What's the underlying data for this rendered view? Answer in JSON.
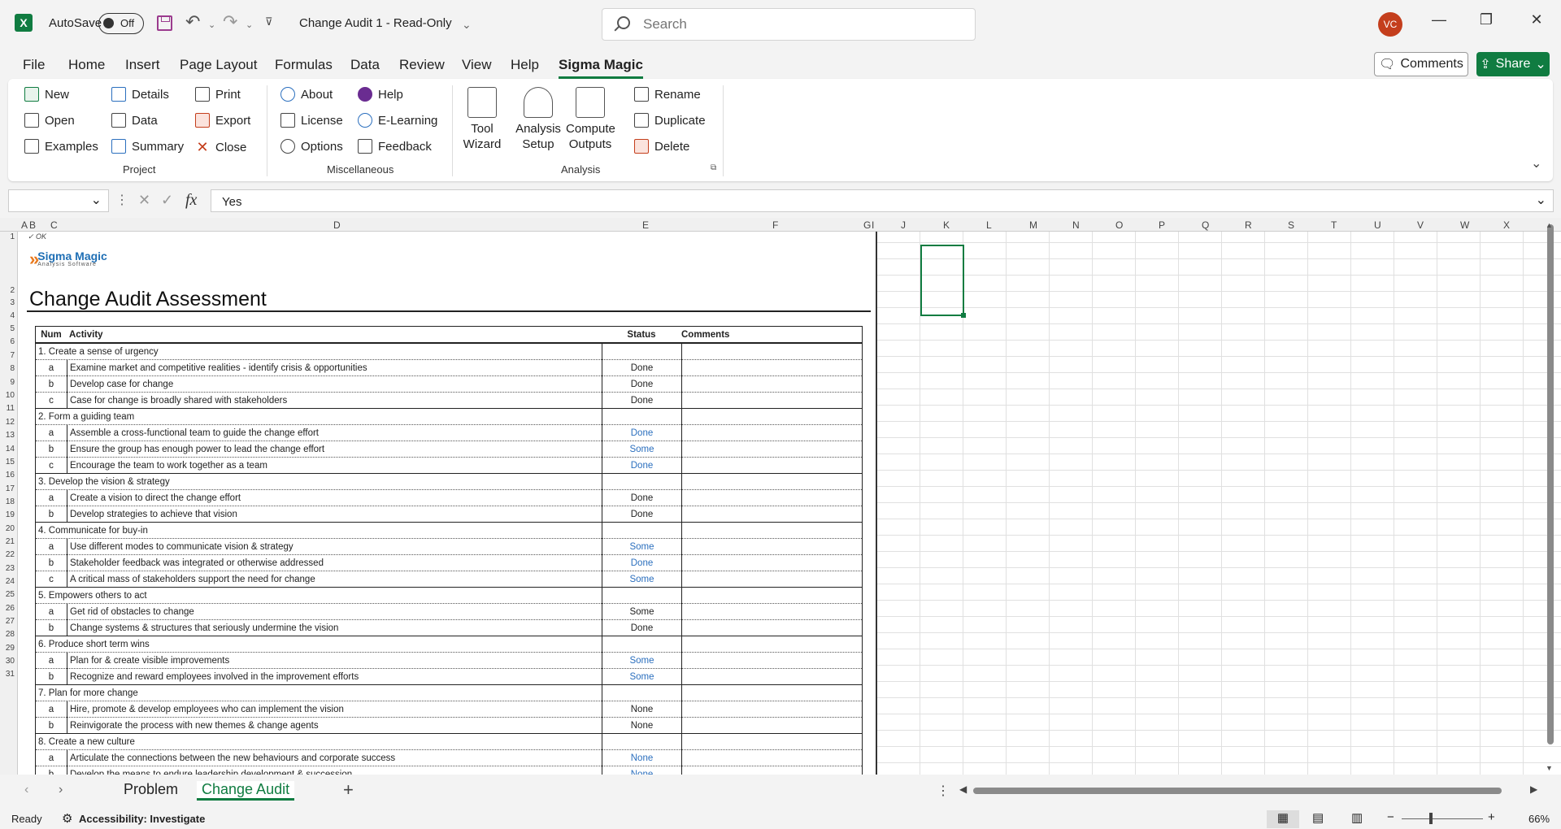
{
  "titlebar": {
    "autosave_label": "AutoSave",
    "autosave_state": "Off",
    "document_title": "Change Audit 1  -  Read-Only",
    "search_placeholder": "Search",
    "avatar_initials": "VC"
  },
  "menu": {
    "items": [
      "File",
      "Home",
      "Insert",
      "Page Layout",
      "Formulas",
      "Data",
      "Review",
      "View",
      "Help",
      "Sigma Magic"
    ],
    "active": "Sigma Magic",
    "comments_label": "Comments",
    "share_label": "Share"
  },
  "ribbon": {
    "project": {
      "label": "Project",
      "buttons": [
        "New",
        "Open",
        "Examples",
        "Details",
        "Data",
        "Summary",
        "Print",
        "Export",
        "Close"
      ]
    },
    "misc": {
      "label": "Miscellaneous",
      "buttons": [
        "About",
        "License",
        "Options",
        "Help",
        "E-Learning",
        "Feedback"
      ]
    },
    "analysis": {
      "label": "Analysis",
      "tool_wizard": "Tool Wizard",
      "analysis_setup": "Analysis Setup",
      "compute_outputs": "Compute Outputs",
      "buttons": [
        "Rename",
        "Duplicate",
        "Delete"
      ]
    }
  },
  "formula_bar": {
    "name_box": "",
    "fx": "fx",
    "value": "Yes"
  },
  "columns": [
    "A",
    "B",
    "C",
    "D",
    "E",
    "F",
    "G",
    "I",
    "J",
    "K",
    "L",
    "M",
    "N",
    "O",
    "P",
    "Q",
    "R",
    "S",
    "T",
    "U",
    "V",
    "W",
    "X"
  ],
  "rows": [
    "1",
    "2",
    "3",
    "4",
    "5",
    "6",
    "7",
    "8",
    "9",
    "10",
    "11",
    "12",
    "13",
    "14",
    "15",
    "16",
    "17",
    "18",
    "19",
    "20",
    "21",
    "22",
    "23",
    "24",
    "25",
    "26",
    "27",
    "28",
    "29",
    "30",
    "31"
  ],
  "sheet": {
    "ok_mark": "✓ OK",
    "logo_name": "Sigma Magic",
    "logo_sub": "Analysis Software",
    "title": "Change Audit Assessment",
    "headers": {
      "num": "Num",
      "activity": "Activity",
      "status": "Status",
      "comments": "Comments"
    },
    "rows": [
      {
        "type": "cat",
        "text": "1. Create a sense of urgency"
      },
      {
        "type": "item",
        "num": "a",
        "activity": "Examine market and competitive realities - identify crisis & opportunities",
        "status": "Done",
        "color": "black"
      },
      {
        "type": "item",
        "num": "b",
        "activity": "Develop case for change",
        "status": "Done",
        "color": "black"
      },
      {
        "type": "item",
        "num": "c",
        "activity": "Case for change is broadly shared with stakeholders",
        "status": "Done",
        "color": "black"
      },
      {
        "type": "cat",
        "text": "2. Form a guiding team"
      },
      {
        "type": "item",
        "num": "a",
        "activity": "Assemble a cross-functional team to guide the change effort",
        "status": "Done",
        "color": "blue"
      },
      {
        "type": "item",
        "num": "b",
        "activity": "Ensure the group has enough power to lead the change effort",
        "status": "Some",
        "color": "blue"
      },
      {
        "type": "item",
        "num": "c",
        "activity": "Encourage the team to work together as a team",
        "status": "Done",
        "color": "blue"
      },
      {
        "type": "cat",
        "text": "3. Develop the vision & strategy"
      },
      {
        "type": "item",
        "num": "a",
        "activity": "Create a vision to direct the change effort",
        "status": "Done",
        "color": "black"
      },
      {
        "type": "item",
        "num": "b",
        "activity": "Develop strategies to achieve that vision",
        "status": "Done",
        "color": "black"
      },
      {
        "type": "cat",
        "text": "4. Communicate for buy-in"
      },
      {
        "type": "item",
        "num": "a",
        "activity": "Use different modes to communicate vision & strategy",
        "status": "Some",
        "color": "blue"
      },
      {
        "type": "item",
        "num": "b",
        "activity": "Stakeholder feedback was integrated or otherwise addressed",
        "status": "Done",
        "color": "blue"
      },
      {
        "type": "item",
        "num": "c",
        "activity": "A critical mass of stakeholders support the need for change",
        "status": "Some",
        "color": "blue"
      },
      {
        "type": "cat",
        "text": "5. Empowers others to act"
      },
      {
        "type": "item",
        "num": "a",
        "activity": "Get rid of obstacles to change",
        "status": "Some",
        "color": "black"
      },
      {
        "type": "item",
        "num": "b",
        "activity": "Change systems & structures that seriously undermine the vision",
        "status": "Done",
        "color": "black"
      },
      {
        "type": "cat",
        "text": "6. Produce short term wins"
      },
      {
        "type": "item",
        "num": "a",
        "activity": "Plan for & create visible improvements",
        "status": "Some",
        "color": "blue"
      },
      {
        "type": "item",
        "num": "b",
        "activity": "Recognize and reward employees involved in the improvement efforts",
        "status": "Some",
        "color": "blue"
      },
      {
        "type": "cat",
        "text": "7. Plan for more change"
      },
      {
        "type": "item",
        "num": "a",
        "activity": "Hire, promote & develop employees who can implement the vision",
        "status": "None",
        "color": "black"
      },
      {
        "type": "item",
        "num": "b",
        "activity": "Reinvigorate the process with new themes & change agents",
        "status": "None",
        "color": "black"
      },
      {
        "type": "cat",
        "text": "8. Create a new culture"
      },
      {
        "type": "item",
        "num": "a",
        "activity": "Articulate the connections between the new behaviours and corporate success",
        "status": "None",
        "color": "blue"
      },
      {
        "type": "item",
        "num": "b",
        "activity": "Develop the means to endure leadership development & succession",
        "status": "None",
        "color": "blue"
      }
    ]
  },
  "tabs": [
    "Problem",
    "Change Audit"
  ],
  "active_tab": "Change Audit",
  "status": {
    "ready": "Ready",
    "accessibility": "Accessibility: Investigate",
    "zoom": "66%"
  },
  "colors": {
    "accent": "#107c41",
    "link_blue": "#2b6fbe"
  }
}
